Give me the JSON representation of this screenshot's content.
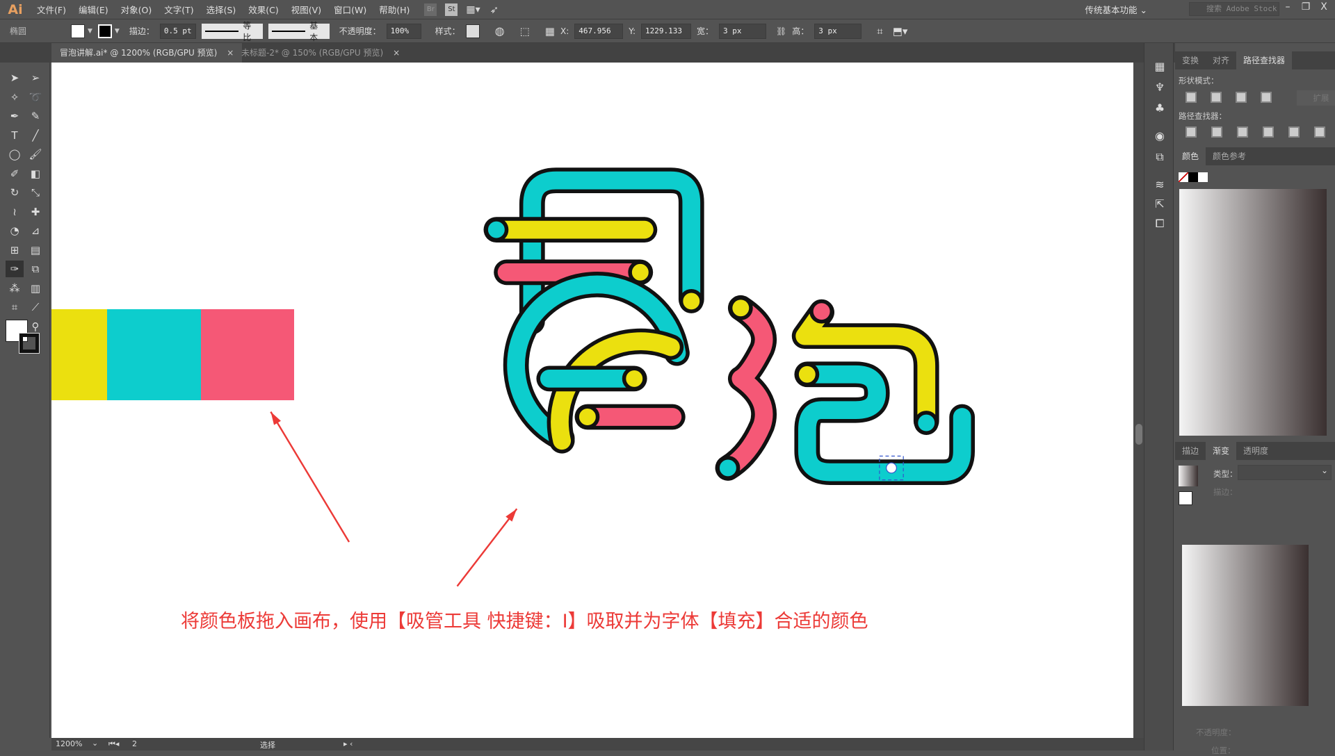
{
  "app": {
    "logo": "Ai",
    "workspace": "传统基本功能",
    "stock_search_placeholder": "搜索 Adobe Stock",
    "bridge": "Br",
    "stock": "St"
  },
  "menu": [
    "文件(F)",
    "编辑(E)",
    "对象(O)",
    "文字(T)",
    "选择(S)",
    "效果(C)",
    "视图(V)",
    "窗口(W)",
    "帮助(H)"
  ],
  "window_controls": {
    "minimize": "–",
    "restore": "❐",
    "close": "X"
  },
  "control_bar": {
    "object_type": "椭圆",
    "stroke_label": "描边：",
    "stroke_weight": "0.5 pt",
    "stroke_profile": "等比",
    "brush": "基本",
    "opacity_label": "不透明度：",
    "opacity": "100%",
    "style_label": "样式：",
    "x_label": "X:",
    "x_value": "467.956",
    "y_label": "Y:",
    "y_value": "1229.133",
    "w_label": "宽：",
    "w_value": "3 px",
    "h_label": "高：",
    "h_value": "3 px"
  },
  "tabs": [
    {
      "label": "冒泡讲解.ai* @ 1200% (RGB/GPU 预览)",
      "close": "×"
    },
    {
      "label": "未标题-2* @ 150% (RGB/GPU 预览)",
      "close": "×"
    }
  ],
  "tools": [
    "selection",
    "direct-selection",
    "magic-wand",
    "lasso",
    "pen",
    "curvature",
    "type",
    "line",
    "ellipse",
    "paintbrush",
    "shaper",
    "eraser",
    "rotate",
    "scale",
    "warp",
    "pin",
    "shape-builder",
    "perspective",
    "mesh",
    "gradient",
    "eyedropper",
    "blend",
    "symbol-sprayer",
    "column-graph",
    "artboard",
    "slice",
    "hand",
    "zoom"
  ],
  "swatches": {
    "yellow": "#ebe00f",
    "cyan": "#0dcdcd",
    "pink": "#f55876"
  },
  "panels": {
    "top_tabs": [
      "变换",
      "对齐",
      "路径查找器"
    ],
    "shape_modes_label": "形状模式：",
    "expand_label": "扩展",
    "pathfinders_label": "路径查找器：",
    "color_tabs": [
      "颜色",
      "颜色参考"
    ],
    "gradient_tabs": [
      "描边",
      "渐变",
      "透明度"
    ],
    "type_label": "类型：",
    "stroke_label": "描边：",
    "opacity_label": "不透明度：",
    "location_label": "位置："
  },
  "status": {
    "zoom": "1200%",
    "page": "2",
    "tool": "选择"
  },
  "annotation": "将颜色板拖入画布，使用【吸管工具 快捷键：I】吸取并为字体【填充】合适的颜色",
  "accent_colors": {
    "annotation": "#ec3a37",
    "outline": "#111111"
  }
}
